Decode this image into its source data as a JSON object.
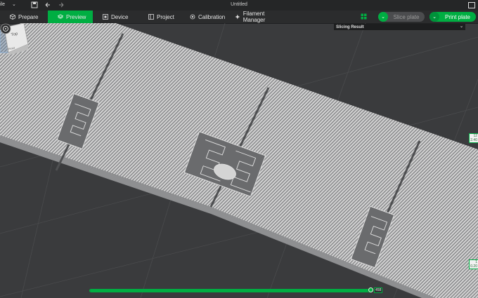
{
  "titlebar": {
    "menu_label": "ile",
    "title": "Untitled"
  },
  "tabs": [
    {
      "label": "Prepare",
      "icon": "cube-outline-icon"
    },
    {
      "label": "Preview",
      "icon": "layers-icon",
      "active": true
    },
    {
      "label": "Device",
      "icon": "device-icon"
    },
    {
      "label": "Project",
      "icon": "project-icon"
    },
    {
      "label": "Calibration",
      "icon": "calibration-icon"
    },
    {
      "label": "Filament Manager",
      "icon": "filament-icon"
    }
  ],
  "actions": {
    "slice_label": "Slice plate",
    "print_label": "Print plate"
  },
  "viewport": {
    "slicing_result_label": "Slicing Result",
    "layer_top": {
      "num": "12",
      "height": "2.40"
    },
    "layer_bottom": {
      "num": "1",
      "height": "0.20"
    },
    "navcube_top": "Top",
    "navcube_front": "Front"
  },
  "slider": {
    "value": "458",
    "fill_fraction": 0.99
  },
  "colors": {
    "accent": "#00ae42",
    "background": "#3a3b3d",
    "part": "#c9c9c9"
  }
}
